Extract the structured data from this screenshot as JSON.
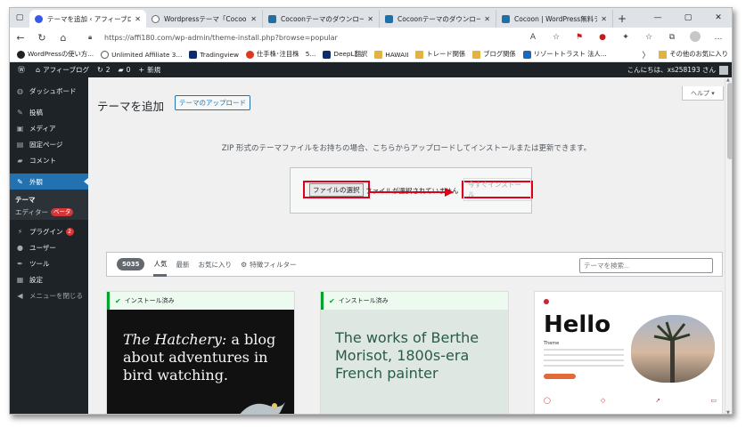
{
  "browser": {
    "tabs": [
      {
        "title": "テーマを追加 ‹ アフィーブログ — ",
        "close": "✕",
        "icon": "wordpress-icon",
        "active": true
      },
      {
        "title": "Wordpressテーマ「Cocoon」の",
        "close": "✕",
        "icon": "globe-icon",
        "active": false
      },
      {
        "title": "Cocoonテーマのダウンロード | Co",
        "close": "✕",
        "icon": "cocoon-icon",
        "active": false
      },
      {
        "title": "Cocoonテーマのダウンロード | Co",
        "close": "✕",
        "icon": "cocoon-icon",
        "active": false
      },
      {
        "title": "Cocoon | WordPress無料テー",
        "close": "✕",
        "icon": "cocoon-icon",
        "active": false
      }
    ],
    "new_tab": "+",
    "window_controls": {
      "minimize": "—",
      "maximize": "▢",
      "close": "✕"
    },
    "url": "https://affi180.com/wp-admin/theme-install.php?browse=popular",
    "bookmarks": [
      {
        "label": "WordPressの使い方...",
        "icon": "dark"
      },
      {
        "label": "Unlimited Affiliate 3...",
        "icon": "circle"
      },
      {
        "label": "Tradingview",
        "icon": "navy"
      },
      {
        "label": "仕手株･注目株　5...",
        "icon": "red"
      },
      {
        "label": "DeepL翻訳",
        "icon": "navy"
      },
      {
        "label": "HAWAII",
        "icon": "folder"
      },
      {
        "label": "トレード関係",
        "icon": "folder"
      },
      {
        "label": "ブログ関係",
        "icon": "folder"
      },
      {
        "label": "リゾートトラスト 法人...",
        "icon": "blue"
      }
    ],
    "other_bookmarks": "その他のお気に入り"
  },
  "adminbar": {
    "site_name": "アフィーブログ",
    "updates": "2",
    "comments": "0",
    "new": "新規",
    "howdy": "こんにちは、xs258193 さん"
  },
  "sidebar": {
    "items": [
      {
        "label": "ダッシュボード",
        "icon": "dashboard-icon",
        "glyph": "◍"
      },
      {
        "label": "投稿",
        "icon": "pin-icon",
        "glyph": "✎"
      },
      {
        "label": "メディア",
        "icon": "media-icon",
        "glyph": "▣"
      },
      {
        "label": "固定ページ",
        "icon": "page-icon",
        "glyph": "▤"
      },
      {
        "label": "コメント",
        "icon": "comment-icon",
        "glyph": "▰"
      }
    ],
    "appearance": {
      "label": "外観",
      "glyph": "✎"
    },
    "sub": {
      "theme": "テーマ",
      "editor": "エディター",
      "beta": "ベータ"
    },
    "items2": [
      {
        "label": "プラグイン",
        "icon": "plugin-icon",
        "glyph": "⚡",
        "badge": "2"
      },
      {
        "label": "ユーザー",
        "icon": "user-icon",
        "glyph": "●"
      },
      {
        "label": "ツール",
        "icon": "tool-icon",
        "glyph": "✒"
      },
      {
        "label": "設定",
        "icon": "settings-icon",
        "glyph": "▦"
      }
    ],
    "collapse": "メニューを閉じる"
  },
  "main": {
    "help": "ヘルプ ▾",
    "title": "テーマを追加",
    "upload_toggle": "テーマのアップロード",
    "description": "ZIP 形式のテーマファイルをお持ちの場合、こちらからアップロードしてインストールまたは更新できます。",
    "file_button": "ファイルの選択",
    "file_none": "ファイルが選択されていません",
    "install_now": "今すぐインストール",
    "count": "5035",
    "filters": [
      "人気",
      "最新",
      "お気に入り"
    ],
    "feature_filter": "特徴フィルター",
    "search_placeholder": "テーマを検索..."
  },
  "themes": [
    {
      "status": "インストール済み",
      "line1": "The Hatchery:",
      "line2": " a blog about adventures in bird watching."
    },
    {
      "status": "インストール済み",
      "text": "The works of Berthe Morisot, 1800s-era French painter"
    },
    {
      "hello": "Hello",
      "sub": "Theme"
    }
  ]
}
